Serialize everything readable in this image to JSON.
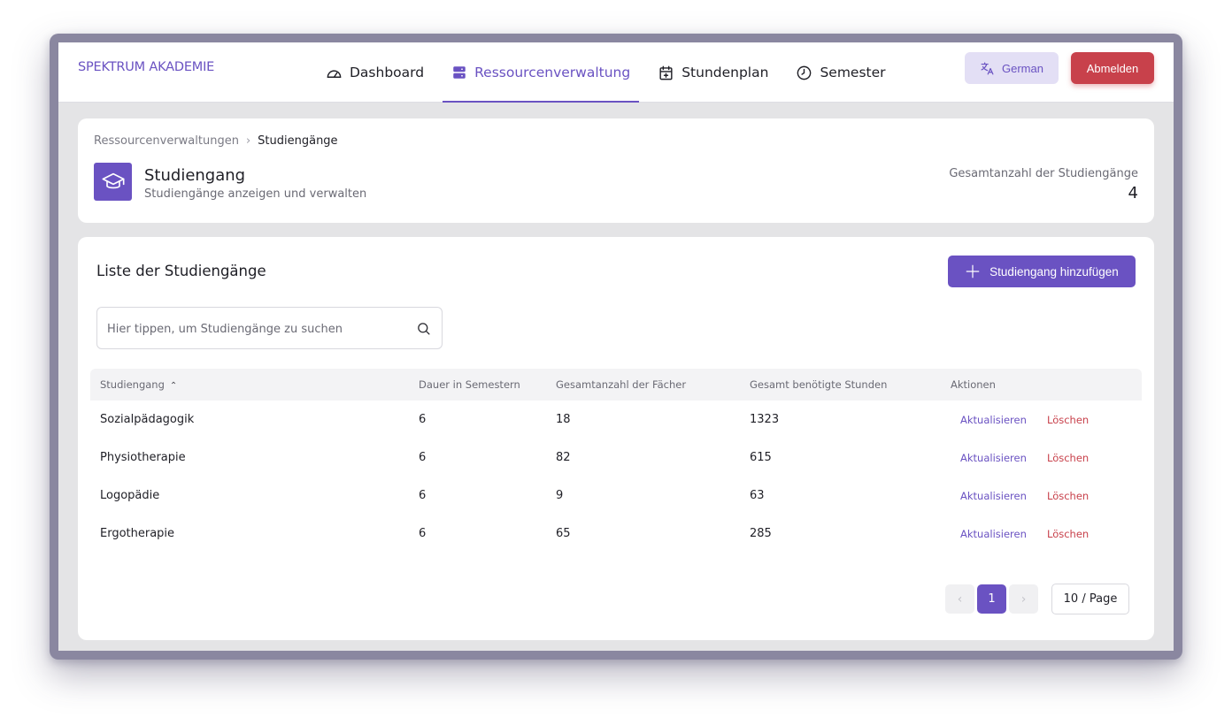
{
  "header": {
    "brand": "SPEKTRUM AKADEMIE",
    "nav": [
      {
        "label": "Dashboard",
        "icon": "gauge-icon"
      },
      {
        "label": "Ressourcenverwaltung",
        "icon": "server-icon",
        "active": true
      },
      {
        "label": "Stundenplan",
        "icon": "calendar-plus-icon"
      },
      {
        "label": "Semester",
        "icon": "clock-icon"
      }
    ],
    "language_label": "German",
    "logout_label": "Abmelden"
  },
  "page": {
    "breadcrumb": [
      "Ressourcenverwaltungen",
      "Studiengänge"
    ],
    "title": "Studiengang",
    "subtitle": "Studiengänge anzeigen und verwalten",
    "total_label": "Gesamtanzahl der Studiengänge",
    "total_value": "4"
  },
  "list": {
    "title": "Liste der Studiengänge",
    "add_label": "Studiengang hinzufügen",
    "search_placeholder": "Hier tippen, um Studiengänge zu suchen",
    "columns": [
      "Studiengang",
      "Dauer in Semestern",
      "Gesamtanzahl der Fächer",
      "Gesamt benötigte Stunden",
      "Aktionen"
    ],
    "rows": [
      {
        "name": "Sozialpädagogik",
        "duration": "6",
        "subjects": "18",
        "hours": "1323"
      },
      {
        "name": "Physiotherapie",
        "duration": "6",
        "subjects": "82",
        "hours": "615"
      },
      {
        "name": "Logopädie",
        "duration": "6",
        "subjects": "9",
        "hours": "63"
      },
      {
        "name": "Ergotherapie",
        "duration": "6",
        "subjects": "65",
        "hours": "285"
      }
    ],
    "action_update": "Aktualisieren",
    "action_delete": "Löschen",
    "pagination": {
      "current_page": "1",
      "page_size": "10 / Page",
      "prev": "‹",
      "next": "›"
    }
  },
  "colors": {
    "accent": "#6a52c2",
    "danger": "#c8414b"
  }
}
